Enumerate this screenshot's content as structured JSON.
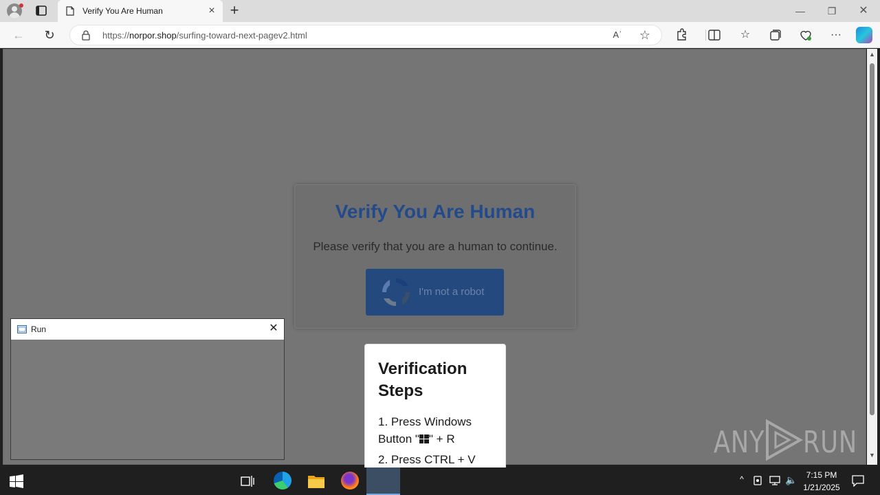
{
  "browser": {
    "tab_title": "Verify You Are Human",
    "url_scheme": "https://",
    "url_host": "norpor.shop",
    "url_path": "/surfing-toward-next-pagev2.html",
    "read_aloud_label": "Aʾ"
  },
  "page": {
    "title": "Verify You Are Human",
    "subtitle": "Please verify that you are a human to continue.",
    "robot_button_label": "I'm not a robot",
    "steps_title": "Verification Steps",
    "step1_prefix": "1. Press Windows Button \"",
    "step1_suffix": "\" + R",
    "step2": "2. Press CTRL + V"
  },
  "run_dialog": {
    "title": "Run"
  },
  "watermark": {
    "left": "ANY",
    "right": "RUN"
  },
  "taskbar": {
    "time": "7:15 PM",
    "date": "1/21/2025"
  },
  "colors": {
    "accent_blue": "#24497f",
    "title_blue": "#234a8a",
    "overlay_gray": "#757575"
  }
}
